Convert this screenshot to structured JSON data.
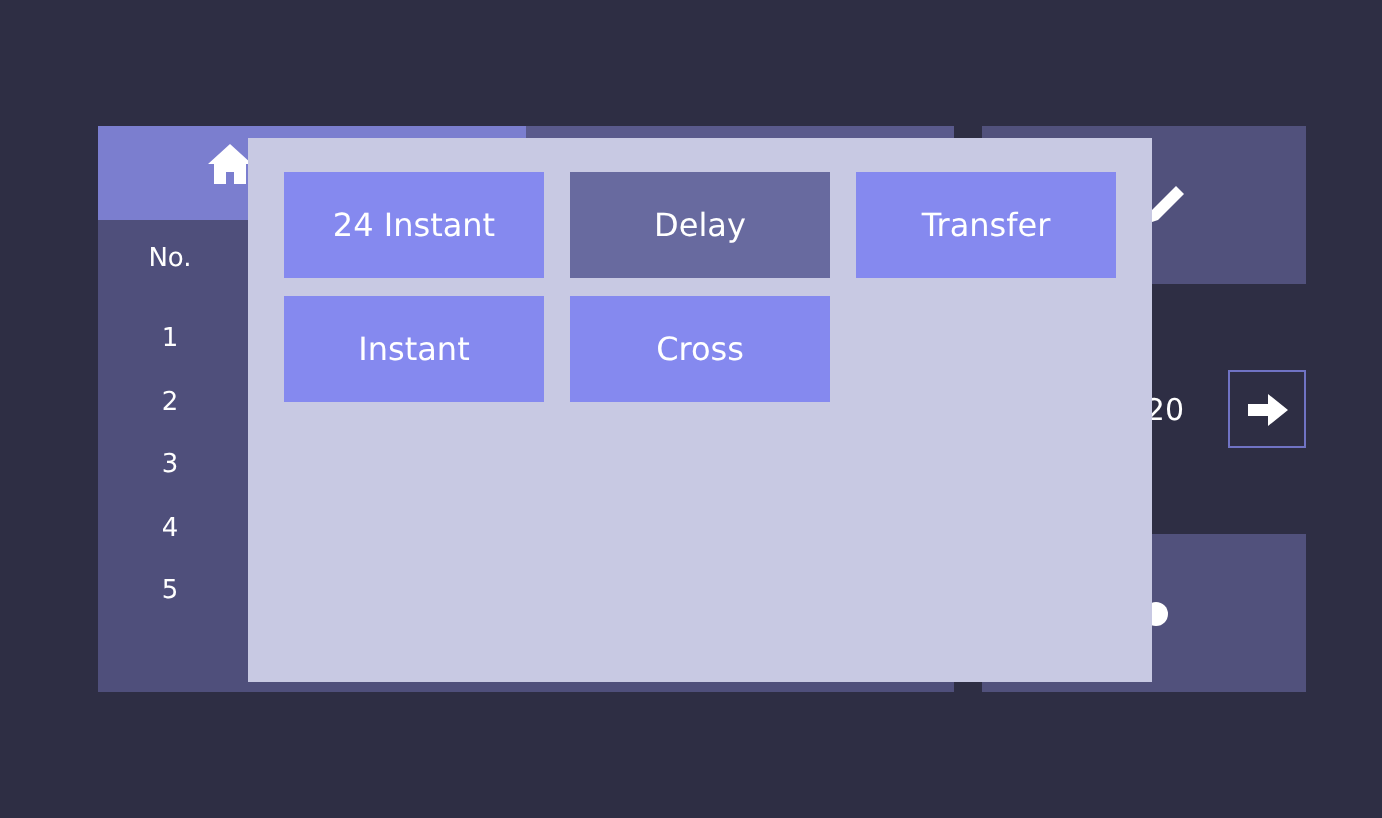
{
  "list_panel": {
    "column_header": "No.",
    "rows": [
      "1",
      "2",
      "3",
      "4",
      "5"
    ]
  },
  "page_indicator": "20",
  "type_menu": {
    "options": [
      {
        "label": "24 Instant",
        "selected": false
      },
      {
        "label": "Delay",
        "selected": true
      },
      {
        "label": "Transfer",
        "selected": false
      },
      {
        "label": "Instant",
        "selected": false
      },
      {
        "label": "Cross",
        "selected": false
      }
    ]
  }
}
